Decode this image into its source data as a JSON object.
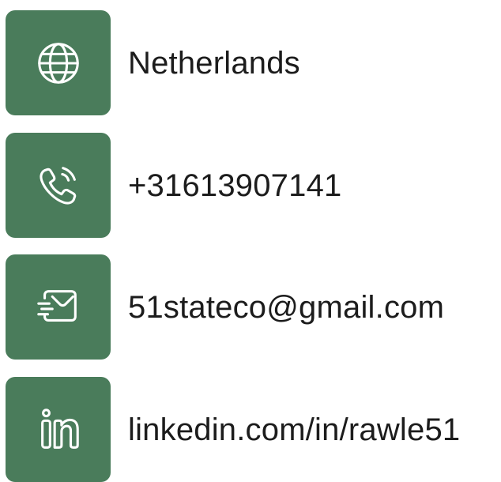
{
  "accent_color": "#4a7c5b",
  "contacts": [
    {
      "icon": "globe-icon",
      "text": "Netherlands"
    },
    {
      "icon": "phone-icon",
      "text": "+31613907141"
    },
    {
      "icon": "mail-icon",
      "text": "51stateco@gmail.com"
    },
    {
      "icon": "linkedin-icon",
      "text": "linkedin.com/in/rawle51"
    }
  ]
}
